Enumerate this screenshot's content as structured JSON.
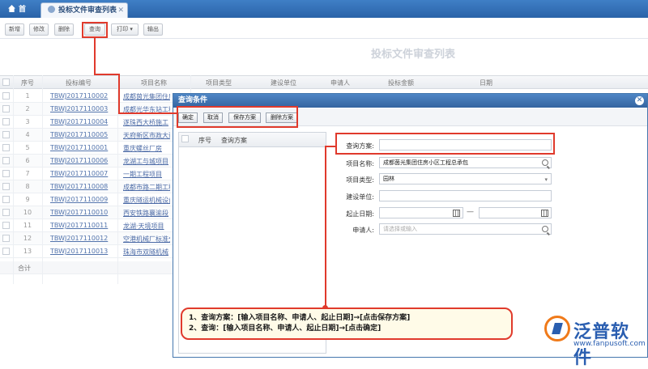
{
  "tabs": {
    "home": "首页",
    "active": "投标文件审查列表"
  },
  "toolbar": {
    "add": "新增",
    "edit": "修改",
    "delete": "删除",
    "query": "查询",
    "print": "打印",
    "export": "输出"
  },
  "list_title": "投标文件审查列表",
  "table": {
    "headers": [
      "序号",
      "投标编号",
      "项目名称",
      "项目类型",
      "建设单位",
      "申请人",
      "投标金额",
      "日期"
    ],
    "rows": [
      {
        "no": "1",
        "code": "TBWJ2017110002",
        "project": "成都茵光集团住房"
      },
      {
        "no": "2",
        "code": "TBWJ2017110003",
        "project": "成都光华东站工程"
      },
      {
        "no": "3",
        "code": "TBWJ2017110004",
        "project": "遂珠西大桥施工"
      },
      {
        "no": "4",
        "code": "TBWJ2017110005",
        "project": "天府新区市政大道"
      },
      {
        "no": "5",
        "code": "TBWJ2017110001",
        "project": "重庆螺丝厂房"
      },
      {
        "no": "6",
        "code": "TBWJ2017110006",
        "project": "龙湖工与城项目"
      },
      {
        "no": "7",
        "code": "TBWJ2017110007",
        "project": "一期工程项目"
      },
      {
        "no": "8",
        "code": "TBWJ2017110008",
        "project": "成都市路二期工程"
      },
      {
        "no": "9",
        "code": "TBWJ2017110009",
        "project": "重庆隧运机械设备"
      },
      {
        "no": "10",
        "code": "TBWJ2017110010",
        "project": "西安铁路襄渝段"
      },
      {
        "no": "11",
        "code": "TBWJ2017110011",
        "project": "龙湖·天境项目"
      },
      {
        "no": "12",
        "code": "TBWJ2017110012",
        "project": "空港机械厂标准分"
      },
      {
        "no": "13",
        "code": "TBWJ2017110013",
        "project": "珠海市双隧机械"
      }
    ],
    "total_label": "合计"
  },
  "modal": {
    "title": "查询条件",
    "buttons": {
      "ok": "确定",
      "cancel": "取消",
      "save": "保存方案",
      "del": "删除方案"
    },
    "plan_list_headers": [
      "序号",
      "查询方案"
    ],
    "fields": {
      "plan_label": "查询方案:",
      "plan_value": "",
      "project_label": "项目名称:",
      "project_value": "成都茵光集团住房小区工程总承包",
      "type_label": "项目类型:",
      "type_value": "园林",
      "unit_label": "建设单位:",
      "unit_value": "",
      "date_label": "起止日期:",
      "date_sep": "—",
      "applicant_label": "申请人:",
      "applicant_placeholder": "请选择或输入"
    }
  },
  "note": {
    "line1": "1、查询方案：[输入项目名称、申请人、起止日期]→[点击保存方案]",
    "line2": "2、查询：[输入项目名称、申请人、起止日期]→[点击确定]"
  },
  "brand": {
    "name": "泛普软件",
    "url": "www.fanpusoft.com"
  },
  "colors": {
    "highlight": "#e03a2c",
    "header_blue": "#3464a0",
    "link": "#5475ad"
  }
}
